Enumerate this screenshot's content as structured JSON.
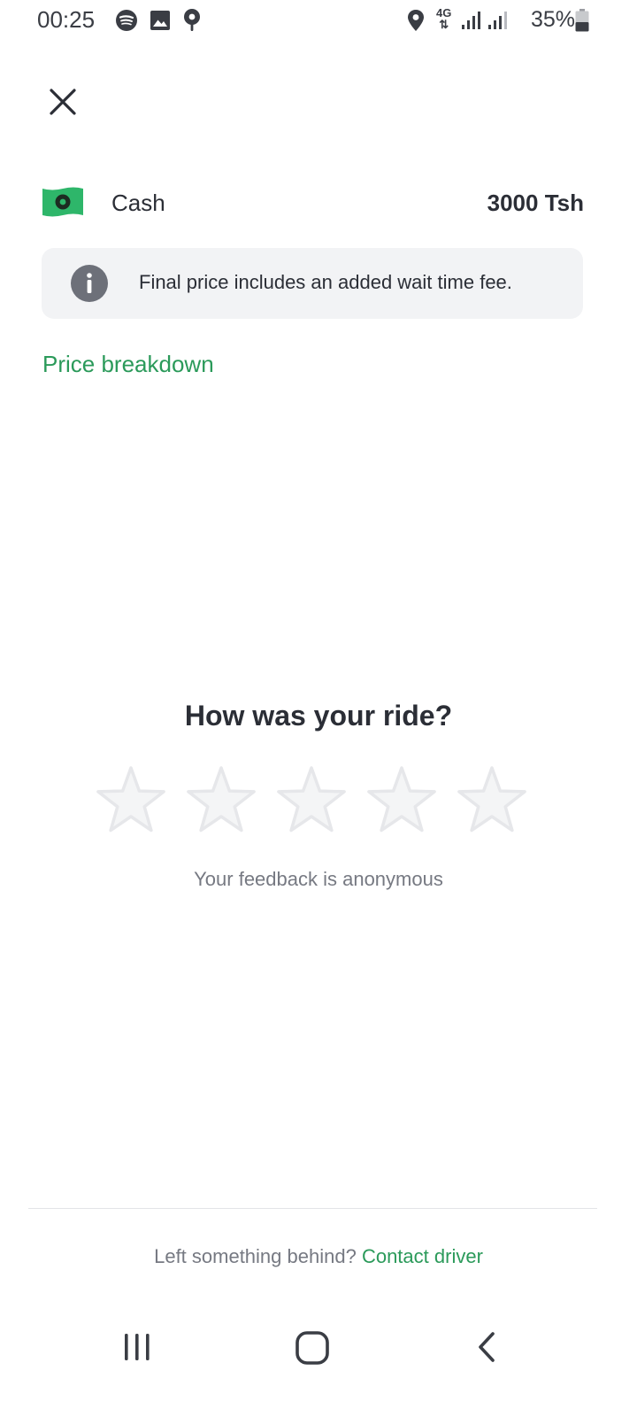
{
  "status_bar": {
    "time": "00:25",
    "battery_percent": "35%",
    "network": "4G",
    "left_icons": [
      "spotify-icon",
      "gallery-icon",
      "location-pin-icon"
    ],
    "right_icons": [
      "location-icon",
      "network-4g-icon",
      "signal-icon",
      "signal-icon",
      "battery-icon"
    ]
  },
  "payment": {
    "method_label": "Cash",
    "amount": "3000 Tsh",
    "icon": "cash-icon"
  },
  "info": {
    "message": "Final price includes an added wait time fee.",
    "icon": "info-icon"
  },
  "price_breakdown_label": "Price breakdown",
  "rating": {
    "title": "How was your ride?",
    "max_stars": 5,
    "selected": 0,
    "note": "Your feedback is anonymous"
  },
  "footer": {
    "prefix": "Left something behind?",
    "link": "Contact driver"
  },
  "colors": {
    "accent": "#2b9a5a",
    "cash_green": "#2eb66a",
    "text_primary": "#2b2e36",
    "text_secondary": "#767982",
    "info_bg": "#f2f3f5",
    "star_fill": "#f4f5f6",
    "star_stroke": "#e6e7ea"
  },
  "nav_bar": {
    "icons": [
      "recent-apps-icon",
      "home-icon",
      "back-icon"
    ]
  }
}
